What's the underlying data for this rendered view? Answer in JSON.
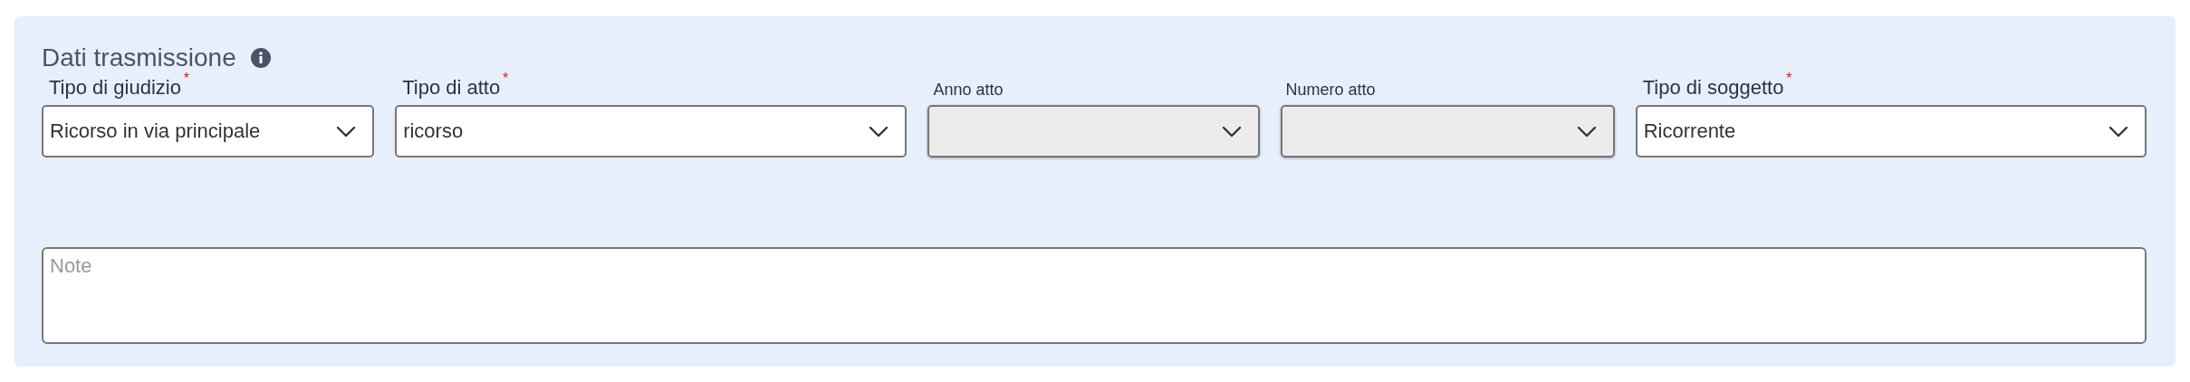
{
  "section": {
    "title": "Dati trasmissione"
  },
  "fields": [
    {
      "label": "Tipo di giudizio",
      "required_mark": "*",
      "disabled": false,
      "value": "Ricorso in via principale"
    },
    {
      "label": "Tipo di atto",
      "required_mark": "*",
      "disabled": false,
      "value": "ricorso"
    },
    {
      "label": "Anno atto",
      "disabled": true
    },
    {
      "label": "Numero atto",
      "disabled": true
    },
    {
      "label": "Tipo di soggetto",
      "required_mark": "*",
      "disabled": false,
      "value": "Ricorrente"
    }
  ],
  "note": {
    "placeholder": "Note"
  }
}
